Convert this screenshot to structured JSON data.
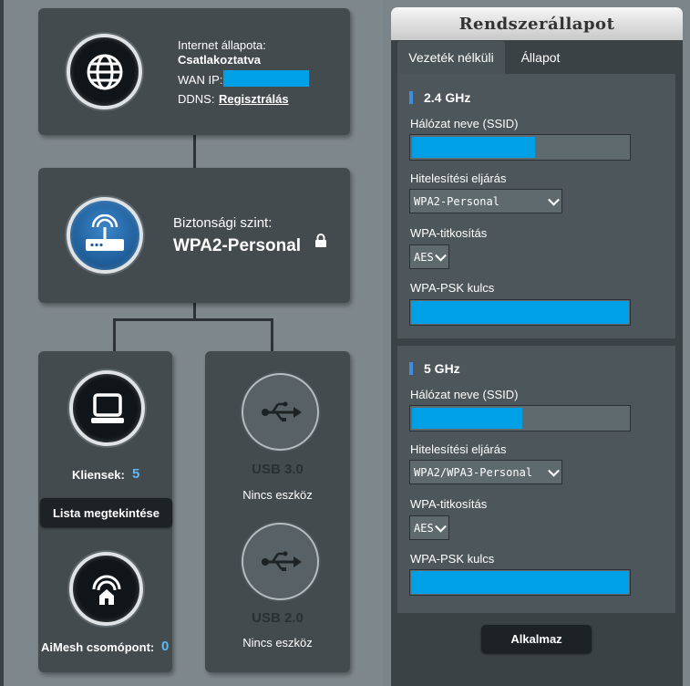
{
  "internet": {
    "status_label": "Internet állapota:",
    "status_value": "Csatlakoztatva",
    "wan_ip_label": "WAN IP:",
    "ddns_label": "DDNS:",
    "ddns_link": "Regisztrálás"
  },
  "router": {
    "security_label": "Biztonsági szint:",
    "security_value": "WPA2-Personal"
  },
  "clients": {
    "label": "Kliensek:",
    "count": "5",
    "view_list_button": "Lista megtekintése"
  },
  "aimesh": {
    "label": "AiMesh csomópont:",
    "count": "0"
  },
  "usb": [
    {
      "name": "USB 3.0",
      "status": "Nincs eszköz"
    },
    {
      "name": "USB 2.0",
      "status": "Nincs eszköz"
    }
  ],
  "panel": {
    "title": "Rendszerállapot",
    "tabs": [
      {
        "label": "Vezeték nélküli"
      },
      {
        "label": "Állapot"
      }
    ],
    "bands": [
      {
        "title": "2.4 GHz",
        "ssid_label": "Hálózat neve (SSID)",
        "auth_label": "Hitelesítési eljárás",
        "auth_value": "WPA2-Personal",
        "enc_label": "WPA-titkosítás",
        "enc_value": "AES",
        "psk_label": "WPA-PSK kulcs"
      },
      {
        "title": "5 GHz",
        "ssid_label": "Hálózat neve (SSID)",
        "auth_label": "Hitelesítési eljárás",
        "auth_value": "WPA2/WPA3-Personal",
        "enc_label": "WPA-titkosítás",
        "enc_value": "AES",
        "psk_label": "WPA-PSK kulcs"
      }
    ],
    "apply_button": "Alkalmaz"
  },
  "colors": {
    "accent": "#00a0e6",
    "section_marker": "#3d8ee0",
    "count": "#63b7f0"
  }
}
